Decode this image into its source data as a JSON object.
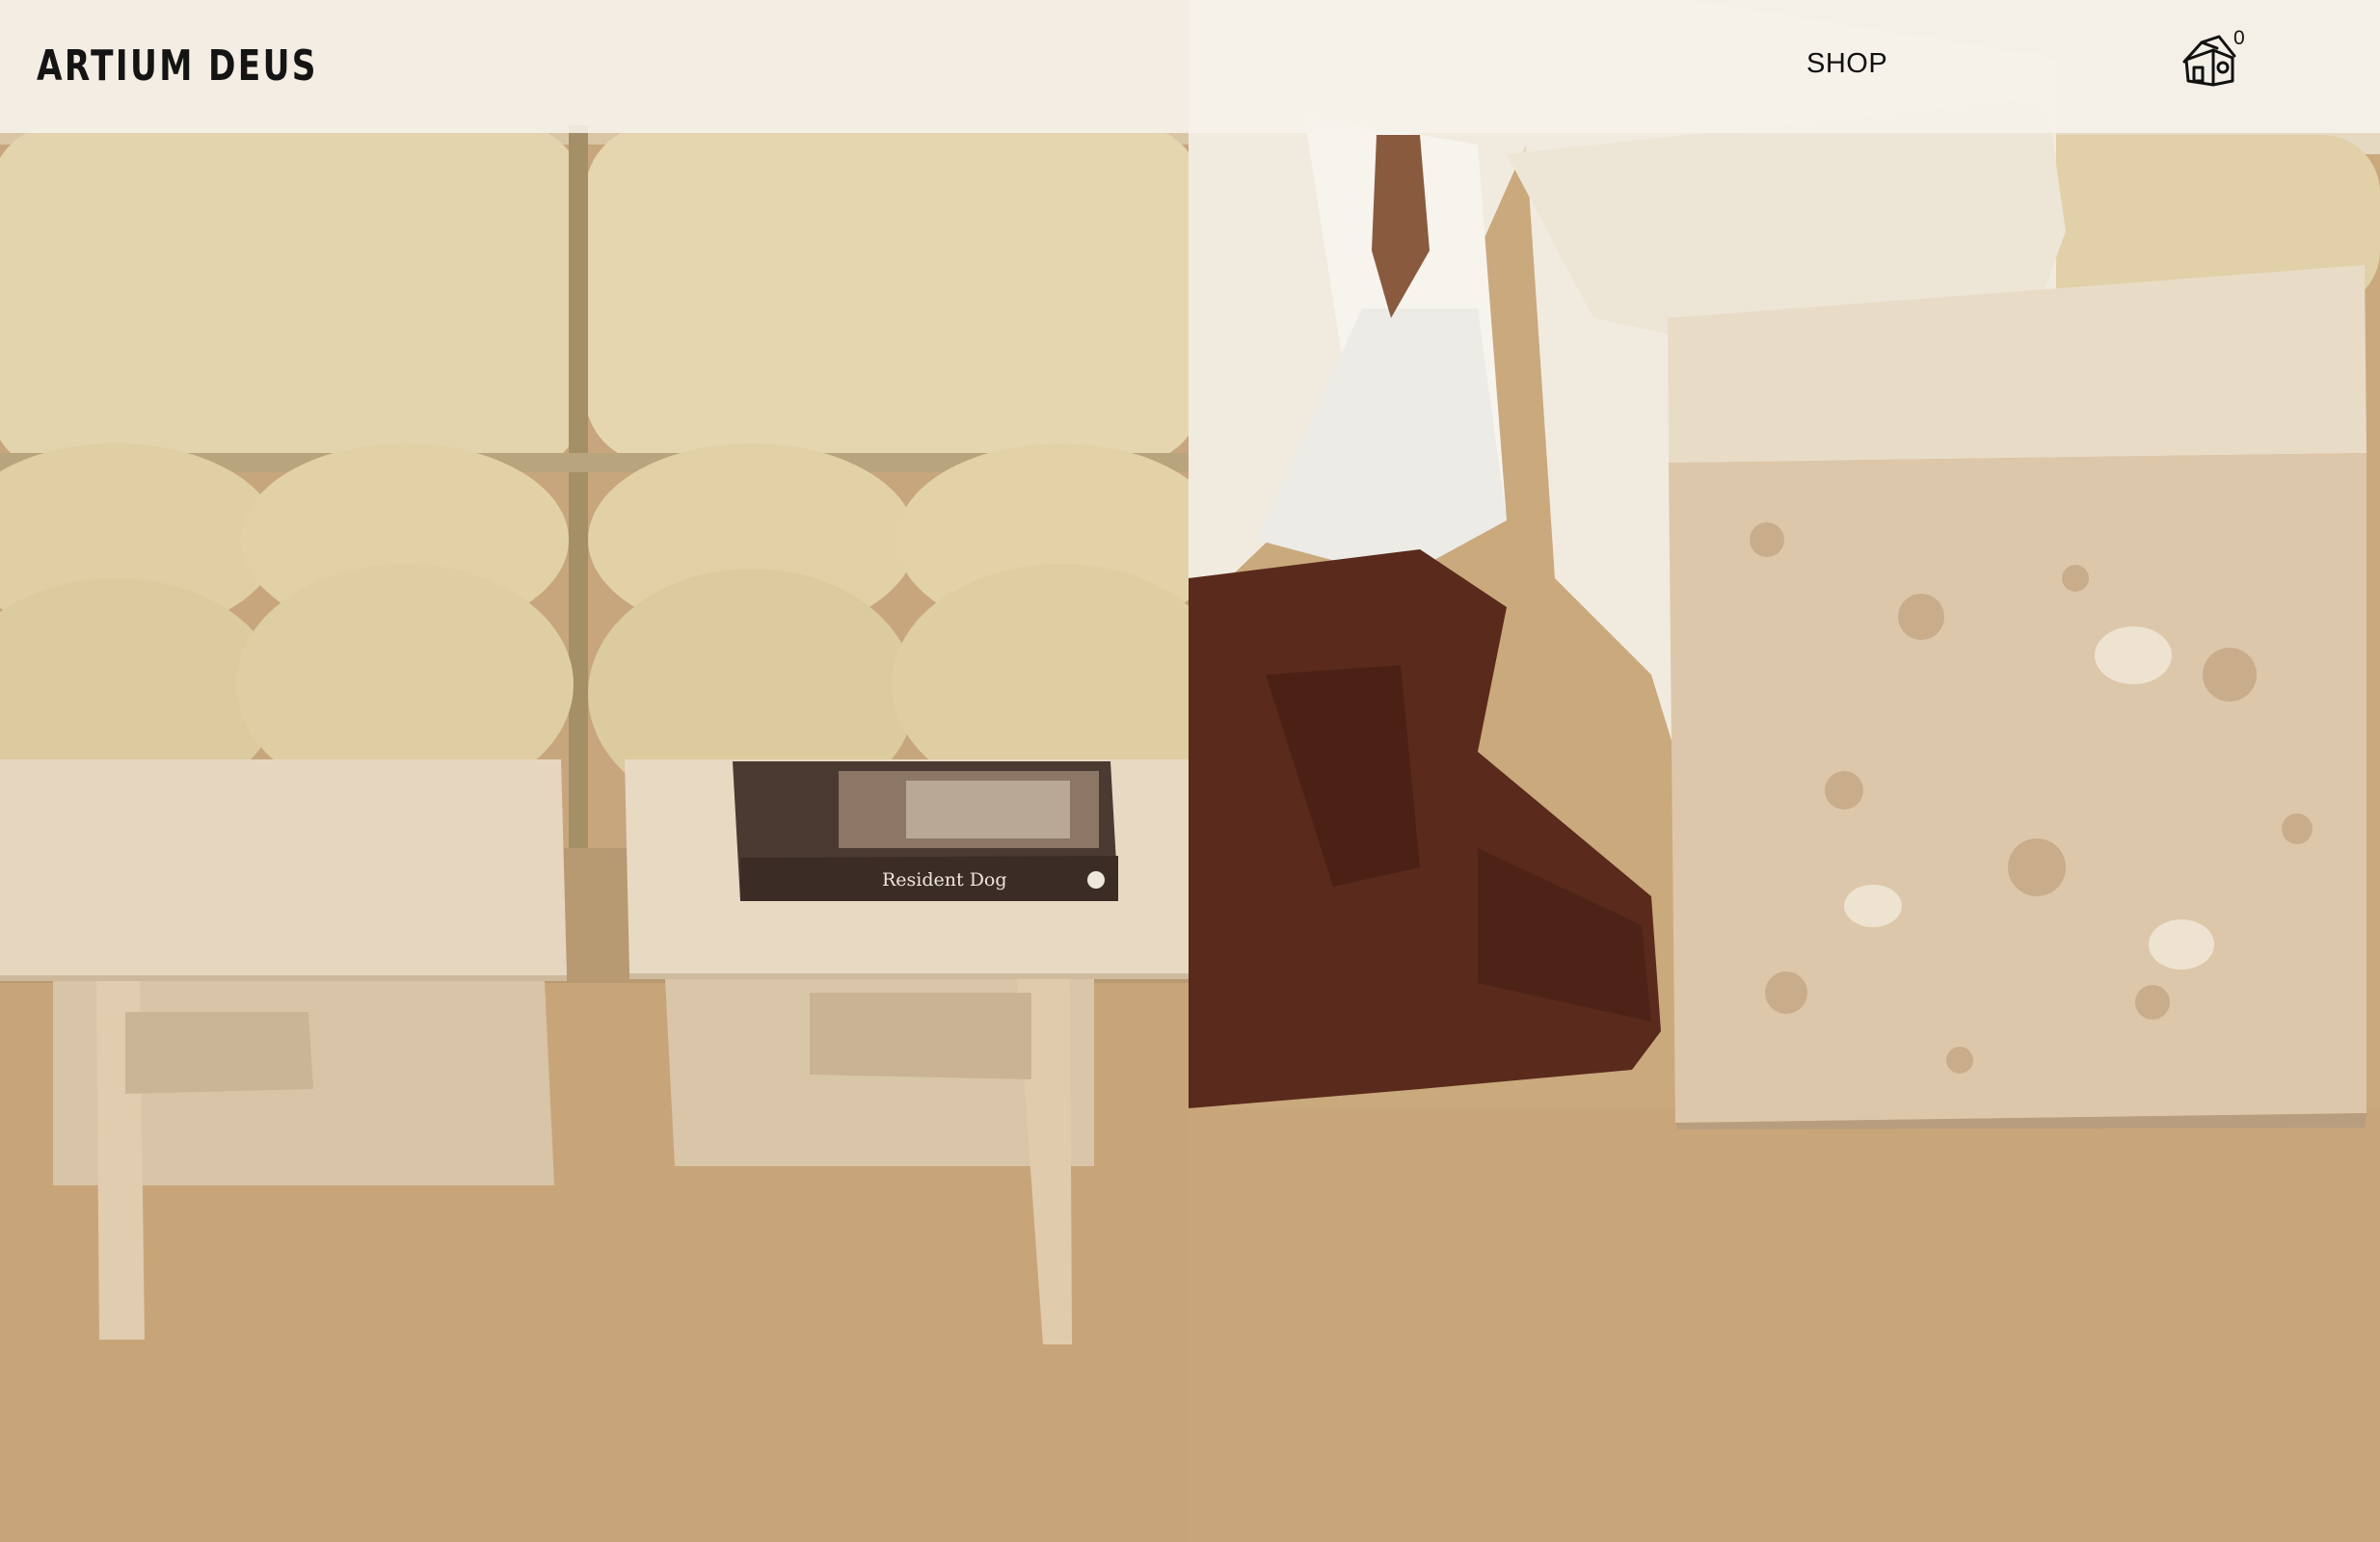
{
  "brand": {
    "name": "ARTIUM DEUS"
  },
  "nav": {
    "shop_label": "SHOP"
  },
  "cart": {
    "icon": "cart-house-icon",
    "count": "0"
  },
  "hero": {
    "left_image": {
      "label": "product-photo-travertine-side-tables",
      "book_title": "Resident Dog"
    },
    "right_image": {
      "label": "product-photo-travertine-cube-side-table"
    }
  },
  "colors": {
    "header_bg": "#f6f2ec",
    "text": "#141414",
    "travertine": "#e6d6bf",
    "sofa": "#e3d3ac",
    "floor": "#c7a57b",
    "trousers": "#5a2a1c"
  }
}
